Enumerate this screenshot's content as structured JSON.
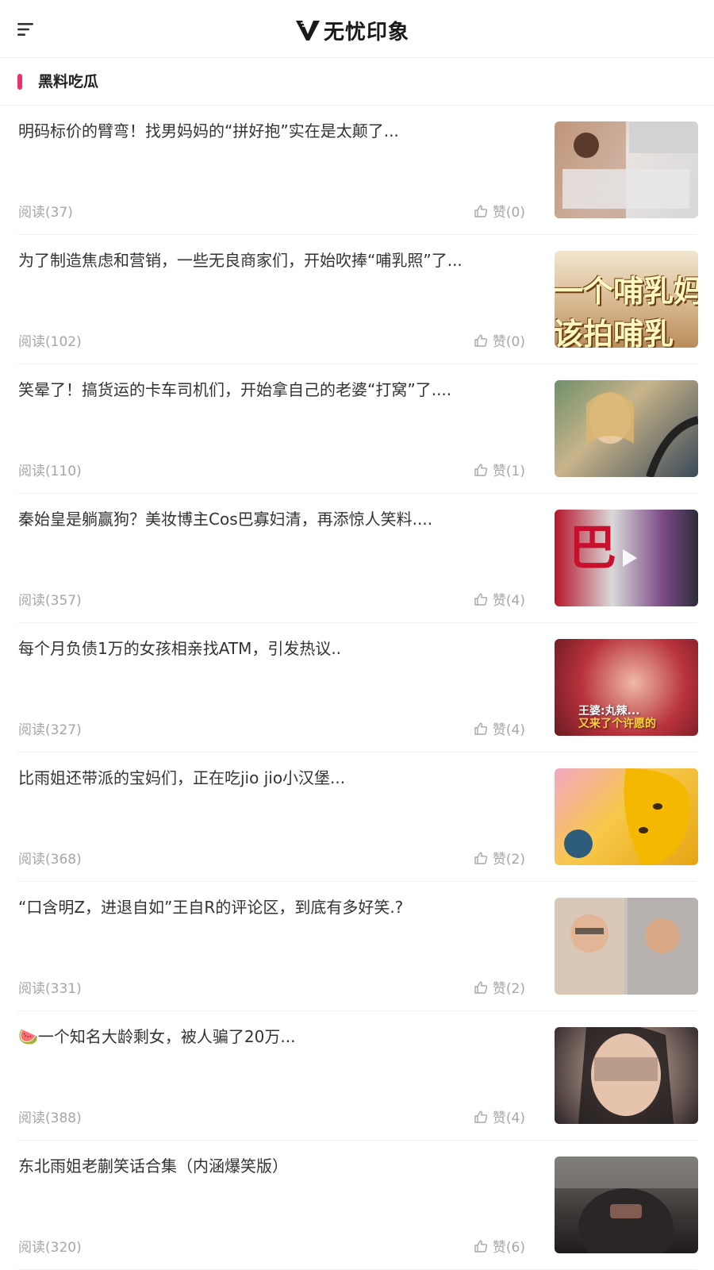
{
  "header": {
    "brand_name": "无忧印象"
  },
  "section": {
    "title": "黑料吃瓜"
  },
  "articles": [
    {
      "title": "明码标价的臂弯！找男妈妈的“拼好抱”实在是太颠了...",
      "reads": "阅读(37)",
      "likes": "赞(0)",
      "thumb_icon": "collage-image"
    },
    {
      "title": "为了制造焦虑和营销，一些无良商家们，开始吹捧“哺乳照”了...",
      "reads": "阅读(102)",
      "likes": "赞(0)",
      "thumb_caption_1": "一个哺乳妈",
      "thumb_caption_2": "该拍哺乳"
    },
    {
      "title": "笑晕了！搞货运的卡车司机们，开始拿自己的老婆“打窝”了....",
      "reads": "阅读(110)",
      "likes": "赞(1)"
    },
    {
      "title": "秦始皇是躺赢狗？美妆博主Cos巴寡妇清，再添惊人笑料....",
      "reads": "阅读(357)",
      "likes": "赞(4)",
      "thumb_caption_1": "巴"
    },
    {
      "title": "每个月负债1万的女孩相亲找ATM，引发热议..",
      "reads": "阅读(327)",
      "likes": "赞(4)",
      "thumb_caption_1": "王婆:丸辣...",
      "thumb_caption_2": "又来了个许愿的"
    },
    {
      "title": "比雨姐还带派的宝妈们，正在吃jio jio小汉堡...",
      "reads": "阅读(368)",
      "likes": "赞(2)"
    },
    {
      "title": "“口含明Z，进退自如”王自R的评论区，到底有多好笑.?",
      "reads": "阅读(331)",
      "likes": "赞(2)"
    },
    {
      "title": "🍉一个知名大龄剩女，被人骗了20万...",
      "reads": "阅读(388)",
      "likes": "赞(4)"
    },
    {
      "title": "东北雨姐老蒯笑话合集（内涵爆笑版）",
      "reads": "阅读(320)",
      "likes": "赞(6)"
    }
  ],
  "colors": {
    "accent": "#e8336e",
    "meta_text": "#a6a6a6",
    "title_text": "#333333"
  }
}
